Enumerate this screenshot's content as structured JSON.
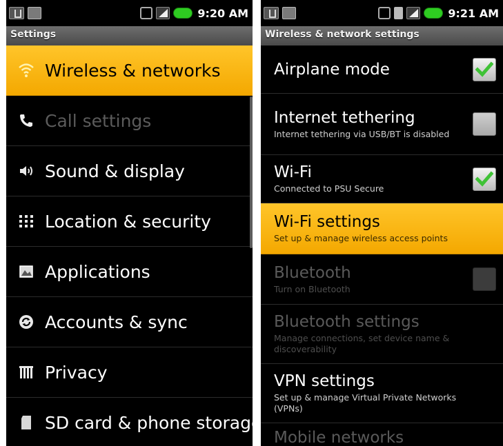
{
  "left": {
    "status_time": "9:20 AM",
    "title": "Settings",
    "items": [
      {
        "label": "Wireless & networks",
        "icon": "wifi-icon"
      },
      {
        "label": "Call settings",
        "icon": "phone-icon"
      },
      {
        "label": "Sound & display",
        "icon": "speaker-icon"
      },
      {
        "label": "Location & security",
        "icon": "grid-icon"
      },
      {
        "label": "Applications",
        "icon": "applications-icon"
      },
      {
        "label": "Accounts & sync",
        "icon": "sync-icon"
      },
      {
        "label": "Privacy",
        "icon": "privacy-icon"
      },
      {
        "label": "SD card & phone storage",
        "icon": "sd-card-icon"
      }
    ]
  },
  "right": {
    "status_time": "9:21 AM",
    "title": "Wireless & network settings",
    "items": [
      {
        "title": "Airplane mode",
        "summary": "",
        "checked": true
      },
      {
        "title": "Internet tethering",
        "summary": "Internet tethering via USB/BT is disabled",
        "checked": false
      },
      {
        "title": "Wi-Fi",
        "summary": "Connected to PSU Secure",
        "checked": true
      },
      {
        "title": "Wi-Fi settings",
        "summary": "Set up & manage wireless access points"
      },
      {
        "title": "Bluetooth",
        "summary": "Turn on Bluetooth",
        "checked": false
      },
      {
        "title": "Bluetooth settings",
        "summary": "Manage connections, set device name & discoverability"
      },
      {
        "title": "VPN settings",
        "summary": "Set up & manage Virtual Private Networks (VPNs)"
      },
      {
        "title": "Mobile networks",
        "summary": ""
      }
    ]
  },
  "colors": {
    "highlight": "#f7b500",
    "check_green": "#3fc236",
    "background": "#000000"
  }
}
